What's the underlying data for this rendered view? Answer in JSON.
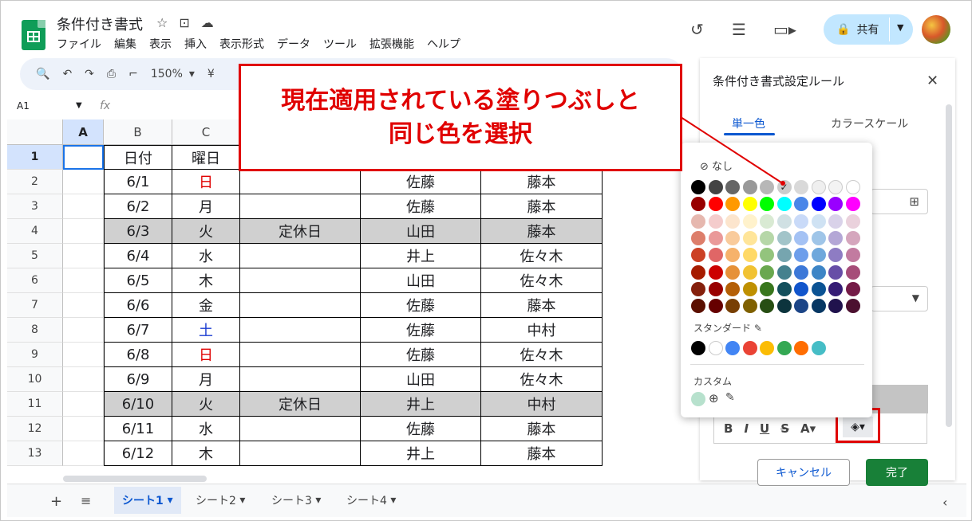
{
  "doc": {
    "title": "条件付き書式"
  },
  "menu": [
    "ファイル",
    "編集",
    "表示",
    "挿入",
    "表示形式",
    "データ",
    "ツール",
    "拡張機能",
    "ヘルプ"
  ],
  "header": {
    "share_label": "共有"
  },
  "toolbar": {
    "zoom": "150%"
  },
  "formula_bar": {
    "name_box": "A1",
    "fx": "fx"
  },
  "columns": [
    "A",
    "B",
    "C"
  ],
  "rows": [
    {
      "num": "1",
      "b": "日付",
      "c": "曜日",
      "d": "",
      "e": "",
      "f": "",
      "gray": false
    },
    {
      "num": "2",
      "b": "6/1",
      "c": "日",
      "d": "",
      "e": "佐藤",
      "f": "藤本",
      "gray": false,
      "c_color": "red"
    },
    {
      "num": "3",
      "b": "6/2",
      "c": "月",
      "d": "",
      "e": "佐藤",
      "f": "藤本",
      "gray": false
    },
    {
      "num": "4",
      "b": "6/3",
      "c": "火",
      "d": "定休日",
      "e": "山田",
      "f": "藤本",
      "gray": true
    },
    {
      "num": "5",
      "b": "6/4",
      "c": "水",
      "d": "",
      "e": "井上",
      "f": "佐々木",
      "gray": false
    },
    {
      "num": "6",
      "b": "6/5",
      "c": "木",
      "d": "",
      "e": "山田",
      "f": "佐々木",
      "gray": false
    },
    {
      "num": "7",
      "b": "6/6",
      "c": "金",
      "d": "",
      "e": "佐藤",
      "f": "藤本",
      "gray": false
    },
    {
      "num": "8",
      "b": "6/7",
      "c": "土",
      "d": "",
      "e": "佐藤",
      "f": "中村",
      "gray": false,
      "c_color": "blue"
    },
    {
      "num": "9",
      "b": "6/8",
      "c": "日",
      "d": "",
      "e": "佐藤",
      "f": "佐々木",
      "gray": false,
      "c_color": "red"
    },
    {
      "num": "10",
      "b": "6/9",
      "c": "月",
      "d": "",
      "e": "山田",
      "f": "佐々木",
      "gray": false
    },
    {
      "num": "11",
      "b": "6/10",
      "c": "火",
      "d": "定休日",
      "e": "井上",
      "f": "中村",
      "gray": true
    },
    {
      "num": "12",
      "b": "6/11",
      "c": "水",
      "d": "",
      "e": "佐藤",
      "f": "藤本",
      "gray": false
    },
    {
      "num": "13",
      "b": "6/12",
      "c": "木",
      "d": "",
      "e": "井上",
      "f": "藤本",
      "gray": false
    }
  ],
  "sheets": [
    "シート1",
    "シート2",
    "シート3",
    "シート4"
  ],
  "panel": {
    "title": "条件付き書式設定ルール",
    "tab_single": "単一色",
    "tab_scale": "カラースケール",
    "cancel": "キャンセル",
    "done": "完了"
  },
  "palette": {
    "none_label": "なし",
    "standard_label": "スタンダード",
    "custom_label": "カスタム",
    "grid": [
      [
        "#000000",
        "#434343",
        "#666666",
        "#999999",
        "#b7b7b7",
        "#cccccc",
        "#d9d9d9",
        "#efefef",
        "#f3f3f3",
        "#ffffff"
      ],
      [
        "#980000",
        "#ff0000",
        "#ff9900",
        "#ffff00",
        "#00ff00",
        "#00ffff",
        "#4a86e8",
        "#0000ff",
        "#9900ff",
        "#ff00ff"
      ],
      [
        "#e6b8af",
        "#f4cccc",
        "#fce5cd",
        "#fff2cc",
        "#d9ead3",
        "#d0e0e3",
        "#c9daf8",
        "#cfe2f3",
        "#d9d2e9",
        "#ead1dc"
      ],
      [
        "#dd7e6b",
        "#ea9999",
        "#f9cb9c",
        "#ffe599",
        "#b6d7a8",
        "#a2c4c9",
        "#a4c2f4",
        "#9fc5e8",
        "#b4a7d6",
        "#d5a6bd"
      ],
      [
        "#cc4125",
        "#e06666",
        "#f6b26b",
        "#ffd966",
        "#93c47d",
        "#76a5af",
        "#6d9eeb",
        "#6fa8dc",
        "#8e7cc3",
        "#c27ba0"
      ],
      [
        "#a61c00",
        "#cc0000",
        "#e69138",
        "#f1c232",
        "#6aa84f",
        "#45818e",
        "#3c78d8",
        "#3d85c6",
        "#674ea7",
        "#a64d79"
      ],
      [
        "#85200c",
        "#990000",
        "#b45f06",
        "#bf9000",
        "#38761d",
        "#134f5c",
        "#1155cc",
        "#0b5394",
        "#351c75",
        "#741b47"
      ],
      [
        "#5b0f00",
        "#660000",
        "#783f04",
        "#7f6000",
        "#274e13",
        "#0c343d",
        "#1c4587",
        "#073763",
        "#20124d",
        "#4c1130"
      ]
    ],
    "standard": [
      "#000000",
      "#ffffff",
      "#4285f4",
      "#ea4335",
      "#fbbc04",
      "#34a853",
      "#ff6d01",
      "#46bdc6"
    ],
    "custom": [
      "#b7e1cd"
    ]
  },
  "callout": {
    "line1": "現在適用されている塗りつぶしと",
    "line2": "同じ色を選択"
  }
}
